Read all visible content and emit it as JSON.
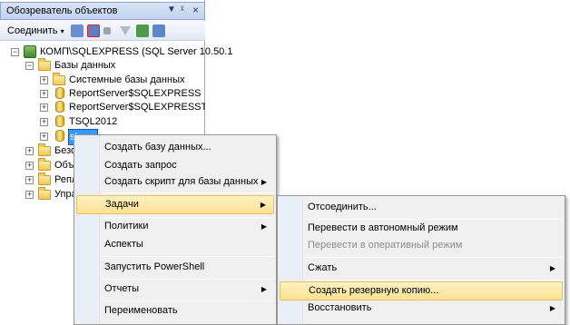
{
  "explorer": {
    "title": "Обозреватель объектов",
    "pin_glyph": "▾ ‡ ×",
    "connect_label": "Соединить",
    "tree": {
      "server": "КОМП\\SQLEXPRESS (SQL Server 10.50.1",
      "databases": "Базы данных",
      "system_dbs": "Системные базы данных",
      "db1": "ReportServer$SQLEXPRESS",
      "db2": "ReportServer$SQLEXPRESSTemp",
      "db3": "TSQL2012",
      "db4": "sbase",
      "folder_security": "Безо",
      "folder_objects": "Объе",
      "folder_replication": "Репл",
      "folder_management": "Упра"
    }
  },
  "context_menu": {
    "items": [
      {
        "label": "Создать базу данных..."
      },
      {
        "label": "Создать запрос"
      },
      {
        "label": "Создать скрипт для базы данных",
        "submenu": true
      },
      {
        "label": "Задачи",
        "submenu": true,
        "highlighted": true
      },
      {
        "label": "Политики",
        "submenu": true
      },
      {
        "label": "Аспекты"
      },
      {
        "label": "Запустить PowerShell"
      },
      {
        "label": "Отчеты",
        "submenu": true
      },
      {
        "label": "Переименовать"
      }
    ]
  },
  "tasks_menu": {
    "items": [
      {
        "label": "Отсоединить..."
      },
      {
        "label": "Перевести в автономный режим"
      },
      {
        "label": "Перевести в оперативный режим",
        "disabled": true
      },
      {
        "label": "Сжать",
        "submenu": true
      },
      {
        "label": "Создать резервную копию...",
        "highlighted": true
      },
      {
        "label": "Восстановить",
        "submenu": true
      }
    ]
  },
  "colors": {
    "highlight": "#fbe193",
    "selection": "#3399ff",
    "menu_bg": "#f0f0f0"
  }
}
